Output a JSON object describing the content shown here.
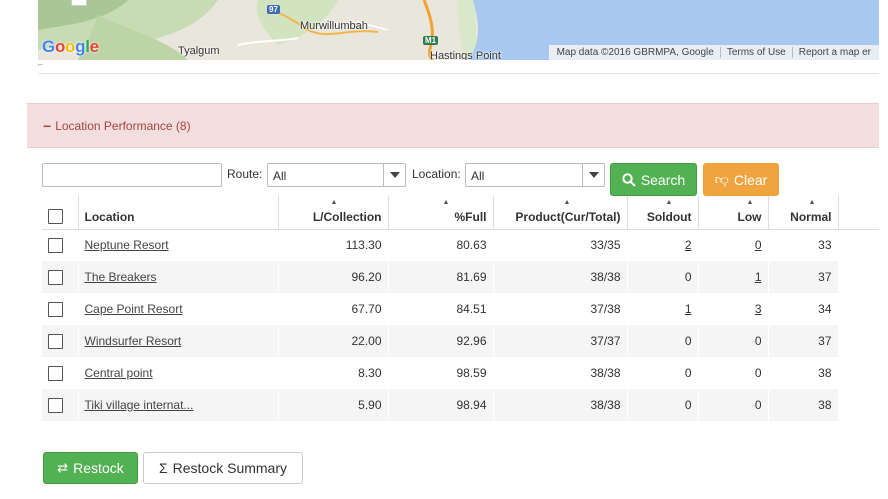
{
  "map": {
    "labels": {
      "murwillumbah": "Murwillumbah",
      "tyalgum": "Tyalgum",
      "hastings_point": "Hastings Point",
      "route_97": "97",
      "route_m1": "M1"
    },
    "google_logo": "Google",
    "attribution": {
      "map_data": "Map data ©2016 GBRMPA, Google",
      "terms": "Terms of Use",
      "report": "Report a map er"
    },
    "zoom_out": "−"
  },
  "panel": {
    "toggle": "−",
    "title": "Location Performance (8)"
  },
  "filters": {
    "search_value": "",
    "route_label": "Route:",
    "route_value": "All",
    "location_label": "Location:",
    "location_value": "All",
    "search_button": "Search",
    "clear_button": "Clear"
  },
  "table": {
    "headers": {
      "location": "Location",
      "collection": "L/Collection",
      "full": "%Full",
      "product": "Product(Cur/Total)",
      "soldout": "Soldout",
      "low": "Low",
      "normal": "Normal"
    },
    "rows": [
      {
        "location": "Neptune Resort",
        "collection": "113.30",
        "full": "80.63",
        "product": "33/35",
        "soldout": "2",
        "low": "0",
        "normal": "33"
      },
      {
        "location": "The Breakers",
        "collection": "96.20",
        "full": "81.69",
        "product": "38/38",
        "soldout": "0",
        "low": "1",
        "normal": "37"
      },
      {
        "location": "Cape Point Resort",
        "collection": "67.70",
        "full": "84.51",
        "product": "37/38",
        "soldout": "1",
        "low": "3",
        "normal": "34"
      },
      {
        "location": "Windsurfer Resort",
        "collection": "22.00",
        "full": "92.96",
        "product": "37/37",
        "soldout": "0",
        "low": "0",
        "normal": "37"
      },
      {
        "location": "Central point",
        "collection": "8.30",
        "full": "98.59",
        "product": "38/38",
        "soldout": "0",
        "low": "0",
        "normal": "38"
      },
      {
        "location": "Tiki village internat...",
        "collection": "5.90",
        "full": "98.94",
        "product": "38/38",
        "soldout": "0",
        "low": "0",
        "normal": "38"
      }
    ]
  },
  "actions": {
    "restock": "Restock",
    "restock_summary": "Restock Summary"
  },
  "colors": {
    "success": "#52b152",
    "warning": "#f0a43f",
    "danger_bg": "#f2dede",
    "danger_text": "#a94442",
    "ocean": "#a8c8f0"
  }
}
